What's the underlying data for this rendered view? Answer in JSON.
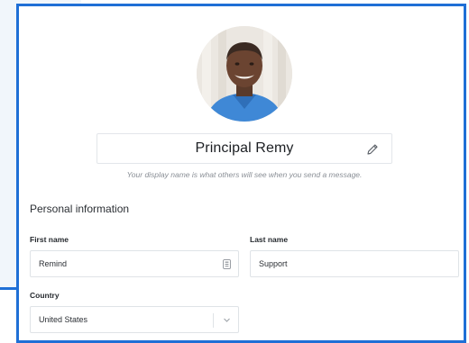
{
  "profile": {
    "display_name": "Principal Remy",
    "display_name_hint": "Your display name is what others will see when you send a message."
  },
  "personal_info": {
    "section_title": "Personal information",
    "first_name": {
      "label": "First name",
      "value": "Remind"
    },
    "last_name": {
      "label": "Last name",
      "value": "Support"
    },
    "country": {
      "label": "Country",
      "value": "United States"
    }
  },
  "icons": {
    "edit": "pencil-icon",
    "autofill": "contact-card-icon",
    "dropdown": "chevron-down-icon"
  },
  "colors": {
    "accent": "#1f6fd6",
    "border": "#dfe3e7",
    "text": "#1c1f23",
    "hint": "#8a8f96"
  }
}
